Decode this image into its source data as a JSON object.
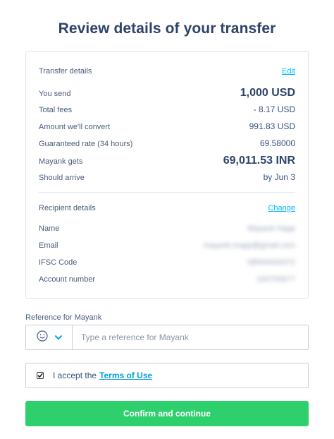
{
  "title": "Review details of your transfer",
  "transfer": {
    "heading": "Transfer details",
    "edit_label": "Edit",
    "you_send_label": "You send",
    "you_send_value": "1,000 USD",
    "fees_label": "Total fees",
    "fees_value": "- 8.17 USD",
    "convert_label": "Amount we'll convert",
    "convert_value": "991.83 USD",
    "rate_label": "Guaranteed rate (34 hours)",
    "rate_value": "69.58000",
    "gets_label": "Mayank gets",
    "gets_value": "69,011.53 INR",
    "arrive_label": "Should arrive",
    "arrive_value": "by Jun 3"
  },
  "recipient": {
    "heading": "Recipient details",
    "change_label": "Change",
    "name_label": "Name",
    "name_value": "Mayank Happ",
    "email_label": "Email",
    "email_value": "mayank.mapp@gmail.com",
    "ifsc_label": "IFSC Code",
    "ifsc_value": "SBIN0000372",
    "account_label": "Account number",
    "account_value": "100755677"
  },
  "reference": {
    "label": "Reference for Mayank",
    "placeholder": "Type a reference for Mayank",
    "emoji_icon": "smiley-icon",
    "chevron_icon": "chevron-down-icon"
  },
  "terms": {
    "checked": true,
    "text": "I accept the",
    "link": "Terms of Use"
  },
  "confirm_label": "Confirm and continue",
  "colors": {
    "primary_text": "#2e4369",
    "link": "#00b9ff",
    "confirm_button": "#2ed06e"
  }
}
